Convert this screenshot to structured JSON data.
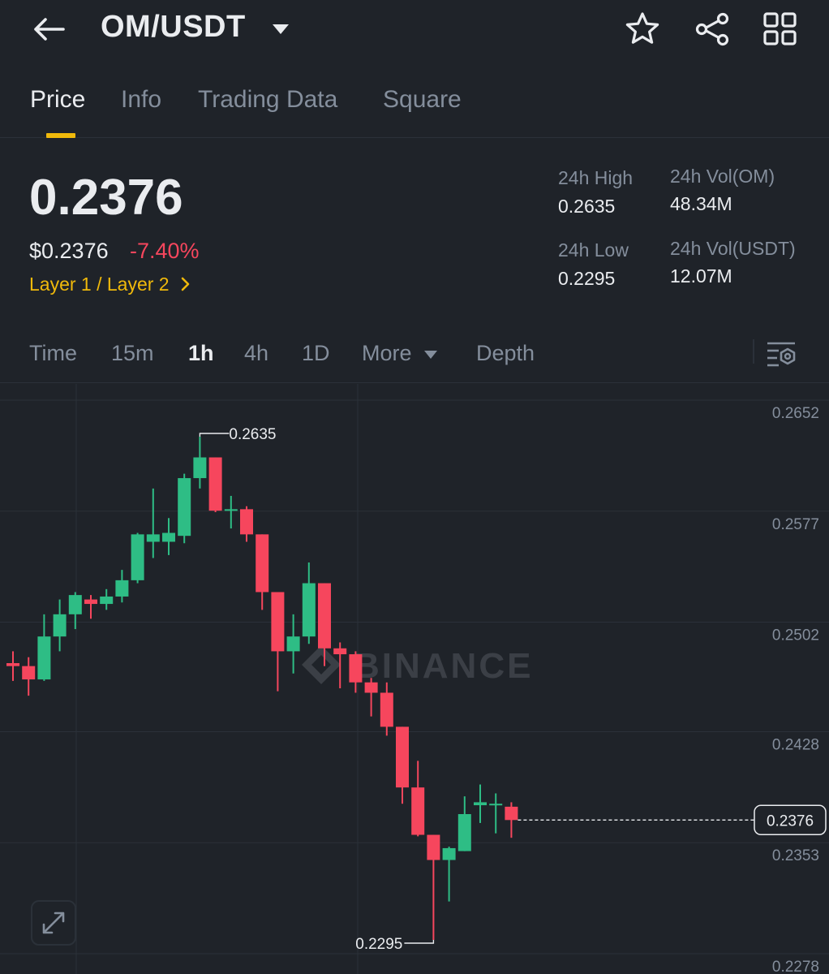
{
  "header": {
    "pair": "OM/USDT",
    "icons": {
      "back": "arrow-left-icon",
      "caret": "caret-down-icon",
      "favorite": "star-icon",
      "share": "share-icon",
      "more": "grid-icon"
    }
  },
  "tabs": [
    {
      "label": "Price",
      "active": true
    },
    {
      "label": "Info",
      "active": false
    },
    {
      "label": "Trading Data",
      "active": false
    },
    {
      "label": "Square",
      "active": false
    }
  ],
  "summary": {
    "last_price": "0.2376",
    "usd_price": "$0.2376",
    "change_pct": "-7.40%",
    "sector": "Layer 1 / Layer 2",
    "sector_chevron": ">",
    "stats": {
      "high_label": "24h High",
      "high_value": "0.2635",
      "low_label": "24h Low",
      "low_value": "0.2295",
      "vol_base_label": "24h Vol(OM)",
      "vol_base_value": "48.34M",
      "vol_quote_label": "24h Vol(USDT)",
      "vol_quote_value": "12.07M"
    }
  },
  "intervals": {
    "items": [
      "Time",
      "15m",
      "1h",
      "4h",
      "1D",
      "More"
    ],
    "active": "1h",
    "depth_label": "Depth",
    "settings_icon": "chart-settings-icon"
  },
  "colors": {
    "background": "#1f2329",
    "up": "#2ebd85",
    "down": "#f6465d",
    "accent": "#f0b90b",
    "muted": "#848e9c",
    "text": "#eaecef",
    "grid": "#2b3139"
  },
  "chart_data": {
    "type": "candlestick",
    "interval": "1h",
    "y_ticks": [
      "0.2652",
      "0.2577",
      "0.2502",
      "0.2428",
      "0.2353",
      "0.2278"
    ],
    "y_range": [
      0.2278,
      0.2652
    ],
    "current_price": "0.2376",
    "high_marker": "0.2635",
    "low_marker": "0.2295",
    "watermark": "BINANCE",
    "candles": [
      {
        "o": 0.2482,
        "h": 0.249,
        "l": 0.247,
        "c": 0.248
      },
      {
        "o": 0.248,
        "h": 0.2486,
        "l": 0.246,
        "c": 0.2471
      },
      {
        "o": 0.2471,
        "h": 0.2515,
        "l": 0.247,
        "c": 0.25
      },
      {
        "o": 0.25,
        "h": 0.2525,
        "l": 0.249,
        "c": 0.2515
      },
      {
        "o": 0.2515,
        "h": 0.253,
        "l": 0.2505,
        "c": 0.2528
      },
      {
        "o": 0.2525,
        "h": 0.2528,
        "l": 0.2512,
        "c": 0.2522
      },
      {
        "o": 0.2522,
        "h": 0.2532,
        "l": 0.2518,
        "c": 0.2527
      },
      {
        "o": 0.2527,
        "h": 0.2545,
        "l": 0.2523,
        "c": 0.2538
      },
      {
        "o": 0.2538,
        "h": 0.257,
        "l": 0.2536,
        "c": 0.2569
      },
      {
        "o": 0.2564,
        "h": 0.26,
        "l": 0.2553,
        "c": 0.2569
      },
      {
        "o": 0.2564,
        "h": 0.258,
        "l": 0.2555,
        "c": 0.257
      },
      {
        "o": 0.2568,
        "h": 0.261,
        "l": 0.2563,
        "c": 0.2607
      },
      {
        "o": 0.2607,
        "h": 0.2635,
        "l": 0.26,
        "c": 0.2621
      },
      {
        "o": 0.2621,
        "h": 0.2621,
        "l": 0.2584,
        "c": 0.2585
      },
      {
        "o": 0.2586,
        "h": 0.2595,
        "l": 0.2573,
        "c": 0.2586
      },
      {
        "o": 0.2586,
        "h": 0.2588,
        "l": 0.2564,
        "c": 0.2569
      },
      {
        "o": 0.2569,
        "h": 0.2569,
        "l": 0.2518,
        "c": 0.253
      },
      {
        "o": 0.253,
        "h": 0.253,
        "l": 0.2463,
        "c": 0.249
      },
      {
        "o": 0.249,
        "h": 0.2515,
        "l": 0.2475,
        "c": 0.25
      },
      {
        "o": 0.25,
        "h": 0.255,
        "l": 0.2495,
        "c": 0.2536
      },
      {
        "o": 0.2536,
        "h": 0.2536,
        "l": 0.248,
        "c": 0.2492
      },
      {
        "o": 0.2492,
        "h": 0.2496,
        "l": 0.2465,
        "c": 0.2488
      },
      {
        "o": 0.2488,
        "h": 0.249,
        "l": 0.2462,
        "c": 0.2469
      },
      {
        "o": 0.2469,
        "h": 0.2472,
        "l": 0.2446,
        "c": 0.2462
      },
      {
        "o": 0.2462,
        "h": 0.2469,
        "l": 0.2433,
        "c": 0.2439
      },
      {
        "o": 0.2439,
        "h": 0.2439,
        "l": 0.2387,
        "c": 0.2398
      },
      {
        "o": 0.2398,
        "h": 0.2416,
        "l": 0.2365,
        "c": 0.2366
      },
      {
        "o": 0.2366,
        "h": 0.2366,
        "l": 0.2295,
        "c": 0.2349
      },
      {
        "o": 0.2349,
        "h": 0.2358,
        "l": 0.2321,
        "c": 0.2357
      },
      {
        "o": 0.2355,
        "h": 0.2392,
        "l": 0.2355,
        "c": 0.238
      },
      {
        "o": 0.2386,
        "h": 0.24,
        "l": 0.2374,
        "c": 0.2388
      },
      {
        "o": 0.2387,
        "h": 0.2394,
        "l": 0.2367,
        "c": 0.2387
      },
      {
        "o": 0.2385,
        "h": 0.2388,
        "l": 0.2364,
        "c": 0.2376
      }
    ]
  }
}
